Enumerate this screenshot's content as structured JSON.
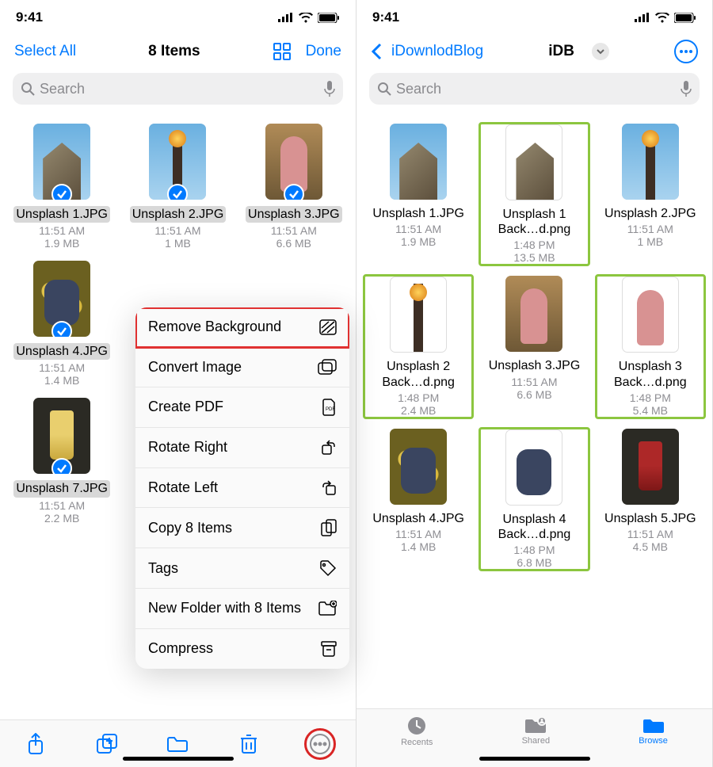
{
  "status": {
    "time": "9:41"
  },
  "left": {
    "nav": {
      "select_all": "Select All",
      "title": "8 Items",
      "done": "Done"
    },
    "search": {
      "placeholder": "Search"
    },
    "files": [
      {
        "name": "Unsplash 1.JPG",
        "time": "11:51 AM",
        "size": "1.9 MB"
      },
      {
        "name": "Unsplash 2.JPG",
        "time": "11:51 AM",
        "size": "1 MB"
      },
      {
        "name": "Unsplash 3.JPG",
        "time": "11:51 AM",
        "size": "6.6 MB"
      },
      {
        "name": "Unsplash 4.JPG",
        "time": "11:51 AM",
        "size": "1.4 MB"
      },
      {
        "name": "Unsplash 7.JPG",
        "time": "11:51 AM",
        "size": "2.2 MB"
      }
    ],
    "menu": {
      "remove_bg": "Remove Background",
      "convert": "Convert Image",
      "create_pdf": "Create PDF",
      "rotate_right": "Rotate Right",
      "rotate_left": "Rotate Left",
      "copy": "Copy 8 Items",
      "tags": "Tags",
      "new_folder": "New Folder with 8 Items",
      "compress": "Compress"
    }
  },
  "right": {
    "nav": {
      "back": "iDownlodBlog",
      "title": "iDB"
    },
    "search": {
      "placeholder": "Search"
    },
    "files": [
      {
        "name": "Unsplash 1.JPG",
        "time": "11:51 AM",
        "size": "1.9 MB",
        "hl": false,
        "kind": "building"
      },
      {
        "name": "Unsplash 1 Back…d.png",
        "time": "1:48 PM",
        "size": "13.5 MB",
        "hl": true,
        "kind": "building-white"
      },
      {
        "name": "Unsplash 2.JPG",
        "time": "11:51 AM",
        "size": "1 MB",
        "hl": false,
        "kind": "tower"
      },
      {
        "name": "Unsplash 2 Back…d.png",
        "time": "1:48 PM",
        "size": "2.4 MB",
        "hl": true,
        "kind": "tower-white"
      },
      {
        "name": "Unsplash 3.JPG",
        "time": "11:51 AM",
        "size": "6.6 MB",
        "hl": false,
        "kind": "person"
      },
      {
        "name": "Unsplash 3 Back…d.png",
        "time": "1:48 PM",
        "size": "5.4 MB",
        "hl": true,
        "kind": "person-white"
      },
      {
        "name": "Unsplash 4.JPG",
        "time": "11:51 AM",
        "size": "1.4 MB",
        "hl": false,
        "kind": "sitter"
      },
      {
        "name": "Unsplash 4 Back…d.png",
        "time": "1:48 PM",
        "size": "6.8 MB",
        "hl": true,
        "kind": "sitter-white"
      },
      {
        "name": "Unsplash 5.JPG",
        "time": "11:51 AM",
        "size": "4.5 MB",
        "hl": false,
        "kind": "drink"
      }
    ],
    "tabs": {
      "recents": "Recents",
      "shared": "Shared",
      "browse": "Browse"
    }
  }
}
